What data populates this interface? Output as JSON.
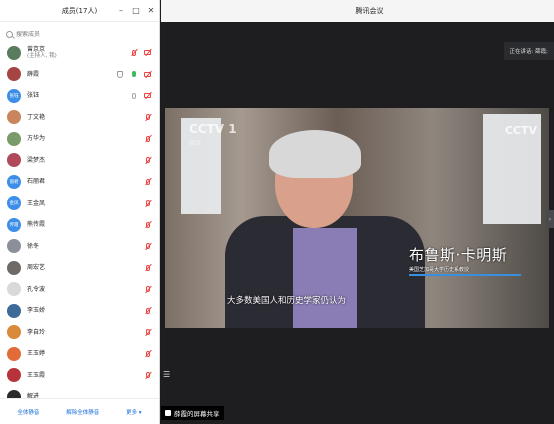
{
  "members_panel": {
    "title": "成员(17人)",
    "search_placeholder": "搜索成员",
    "members": [
      {
        "name": "曾京京",
        "sub": "(主持人, 我)",
        "avatar_text": "",
        "avatar_color": "#5a7b5e",
        "mic": "muted",
        "cam": "off",
        "shield": false
      },
      {
        "name": "薛霞",
        "sub": "",
        "avatar_text": "",
        "avatar_color": "#a64444",
        "mic": "on",
        "cam": "off",
        "shield": true
      },
      {
        "name": "张钰",
        "sub": "",
        "avatar_text": "张钰",
        "avatar_color": "#3d8ee8",
        "mic": "idle",
        "cam": "off",
        "shield": false
      },
      {
        "name": "丁文艳",
        "sub": "",
        "avatar_text": "",
        "avatar_color": "#c8855e",
        "mic": "muted",
        "cam": "",
        "shield": false
      },
      {
        "name": "方华为",
        "sub": "",
        "avatar_text": "",
        "avatar_color": "#7a9a6a",
        "mic": "muted",
        "cam": "",
        "shield": false
      },
      {
        "name": "梁梦杰",
        "sub": "",
        "avatar_text": "",
        "avatar_color": "#b04a5a",
        "mic": "muted",
        "cam": "",
        "shield": false
      },
      {
        "name": "石丽君",
        "sub": "",
        "avatar_text": "丽君",
        "avatar_color": "#3d8ee8",
        "mic": "muted",
        "cam": "",
        "shield": false
      },
      {
        "name": "王金凤",
        "sub": "",
        "avatar_text": "金凤",
        "avatar_color": "#3d8ee8",
        "mic": "muted",
        "cam": "",
        "shield": false
      },
      {
        "name": "熊传霞",
        "sub": "",
        "avatar_text": "传霞",
        "avatar_color": "#3d8ee8",
        "mic": "muted",
        "cam": "",
        "shield": false
      },
      {
        "name": "徐冬",
        "sub": "",
        "avatar_text": "",
        "avatar_color": "#8a8f9a",
        "mic": "muted",
        "cam": "",
        "shield": false
      },
      {
        "name": "周宏艺",
        "sub": "",
        "avatar_text": "",
        "avatar_color": "#6e6a66",
        "mic": "muted",
        "cam": "",
        "shield": false
      },
      {
        "name": "孔令波",
        "sub": "",
        "avatar_text": "",
        "avatar_color": "#d9d9d9",
        "mic": "muted",
        "cam": "",
        "shield": false
      },
      {
        "name": "李玉娇",
        "sub": "",
        "avatar_text": "",
        "avatar_color": "#3e6a9a",
        "mic": "muted",
        "cam": "",
        "shield": false
      },
      {
        "name": "李自玲",
        "sub": "",
        "avatar_text": "",
        "avatar_color": "#d98a3a",
        "mic": "muted",
        "cam": "",
        "shield": false
      },
      {
        "name": "王玉婷",
        "sub": "",
        "avatar_text": "",
        "avatar_color": "#e26b3a",
        "mic": "muted",
        "cam": "",
        "shield": false
      },
      {
        "name": "王玉霞",
        "sub": "",
        "avatar_text": "",
        "avatar_color": "#b8323a",
        "mic": "muted",
        "cam": "",
        "shield": false
      },
      {
        "name": "解进",
        "sub": "",
        "avatar_text": "",
        "avatar_color": "#2a2a2a",
        "mic": "",
        "cam": "",
        "shield": false
      }
    ],
    "footer": {
      "mute_all": "全体静音",
      "unmute_all": "解除全体静音",
      "more": "更多 ▾"
    }
  },
  "meeting": {
    "window_title": "腾讯会议",
    "speaking_label": "正在讲话: 薛霞;",
    "video": {
      "logo_left": "CCTV 1",
      "logo_left_sub": "综合",
      "logo_right": "CCTV",
      "caption_name": "布鲁斯·卡明斯",
      "caption_title": "美国芝加哥大学历史系教授",
      "subtitle": "大多数美国人和历史学家仍认为"
    },
    "share_label": "薛霞的屏幕共享"
  },
  "colors": {
    "accent": "#1a6fd8",
    "mic_on": "#3cbc5a",
    "muted": "#e44444"
  }
}
